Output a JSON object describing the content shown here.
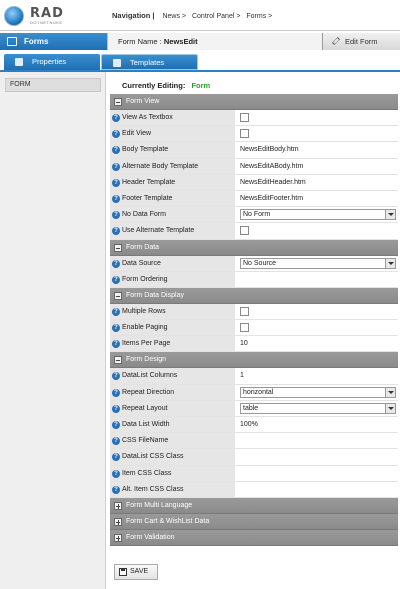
{
  "header": {
    "logo_text": "RAD",
    "logo_subtext": "DOTNETNUKE",
    "nav_label": "Navigation |",
    "breadcrumbs": [
      "News >",
      "Control Panel >",
      "Forms >"
    ]
  },
  "formbar": {
    "title": "Forms",
    "form_name_label": "Form Name :",
    "form_name_value": "NewsEdit",
    "edit_button": "Edit Form"
  },
  "tabs": [
    {
      "label": "Properties",
      "icon": "wrench-icon"
    },
    {
      "label": "Templates",
      "icon": "puzzle-icon"
    }
  ],
  "sidebar": {
    "items": [
      {
        "label": "FORM"
      }
    ]
  },
  "editing": {
    "label": "Currently Editing:",
    "value": "Form"
  },
  "sections": [
    {
      "title": "Form View",
      "rows": [
        {
          "label": "View As Textbox",
          "type": "checkbox",
          "checked": false
        },
        {
          "label": "Edit View",
          "type": "checkbox",
          "checked": false
        },
        {
          "label": "Body Template",
          "type": "text",
          "value": "NewsEditBody.htm"
        },
        {
          "label": "Alternate Body Template",
          "type": "text",
          "value": "NewsEditABody.htm"
        },
        {
          "label": "Header Template",
          "type": "text",
          "value": "NewsEditHeader.htm"
        },
        {
          "label": "Footer Template",
          "type": "text",
          "value": "NewsEditFooter.htm"
        },
        {
          "label": "No Data Form",
          "type": "select",
          "value": "No Form"
        },
        {
          "label": "Use Alternate Template",
          "type": "checkbox",
          "checked": false
        }
      ]
    },
    {
      "title": "Form Data",
      "rows": [
        {
          "label": "Data Source",
          "type": "select",
          "value": "No Source"
        },
        {
          "label": "Form Ordering",
          "type": "text",
          "value": ""
        }
      ]
    },
    {
      "title": "Form Data Display",
      "rows": [
        {
          "label": "Multiple Rows",
          "type": "checkbox",
          "checked": false
        },
        {
          "label": "Enable Paging",
          "type": "checkbox",
          "checked": false
        },
        {
          "label": "Items Per Page",
          "type": "text",
          "value": "10"
        }
      ]
    },
    {
      "title": "Form Design",
      "rows": [
        {
          "label": "DataList Columns",
          "type": "text",
          "value": "1"
        },
        {
          "label": "Repeat Direction",
          "type": "select",
          "value": "horizontal"
        },
        {
          "label": "Repeat Layout",
          "type": "select",
          "value": "table"
        },
        {
          "label": "Data List Width",
          "type": "text",
          "value": "100%"
        },
        {
          "label": "CSS FileName",
          "type": "text",
          "value": ""
        },
        {
          "label": "DataList CSS Class",
          "type": "text",
          "value": ""
        },
        {
          "label": "Item CSS Class",
          "type": "text",
          "value": ""
        },
        {
          "label": "Alt. Item CSS Class",
          "type": "text",
          "value": ""
        }
      ]
    }
  ],
  "collapsed_sections": [
    "Form Multi Language",
    "Form Cart & WishList Data",
    "Form Validation"
  ],
  "save_button": "SAVE",
  "colors": {
    "accent_blue": "#1f6fb2",
    "section_gray": "#8f8f8f",
    "editing_green": "#2aa02a"
  }
}
